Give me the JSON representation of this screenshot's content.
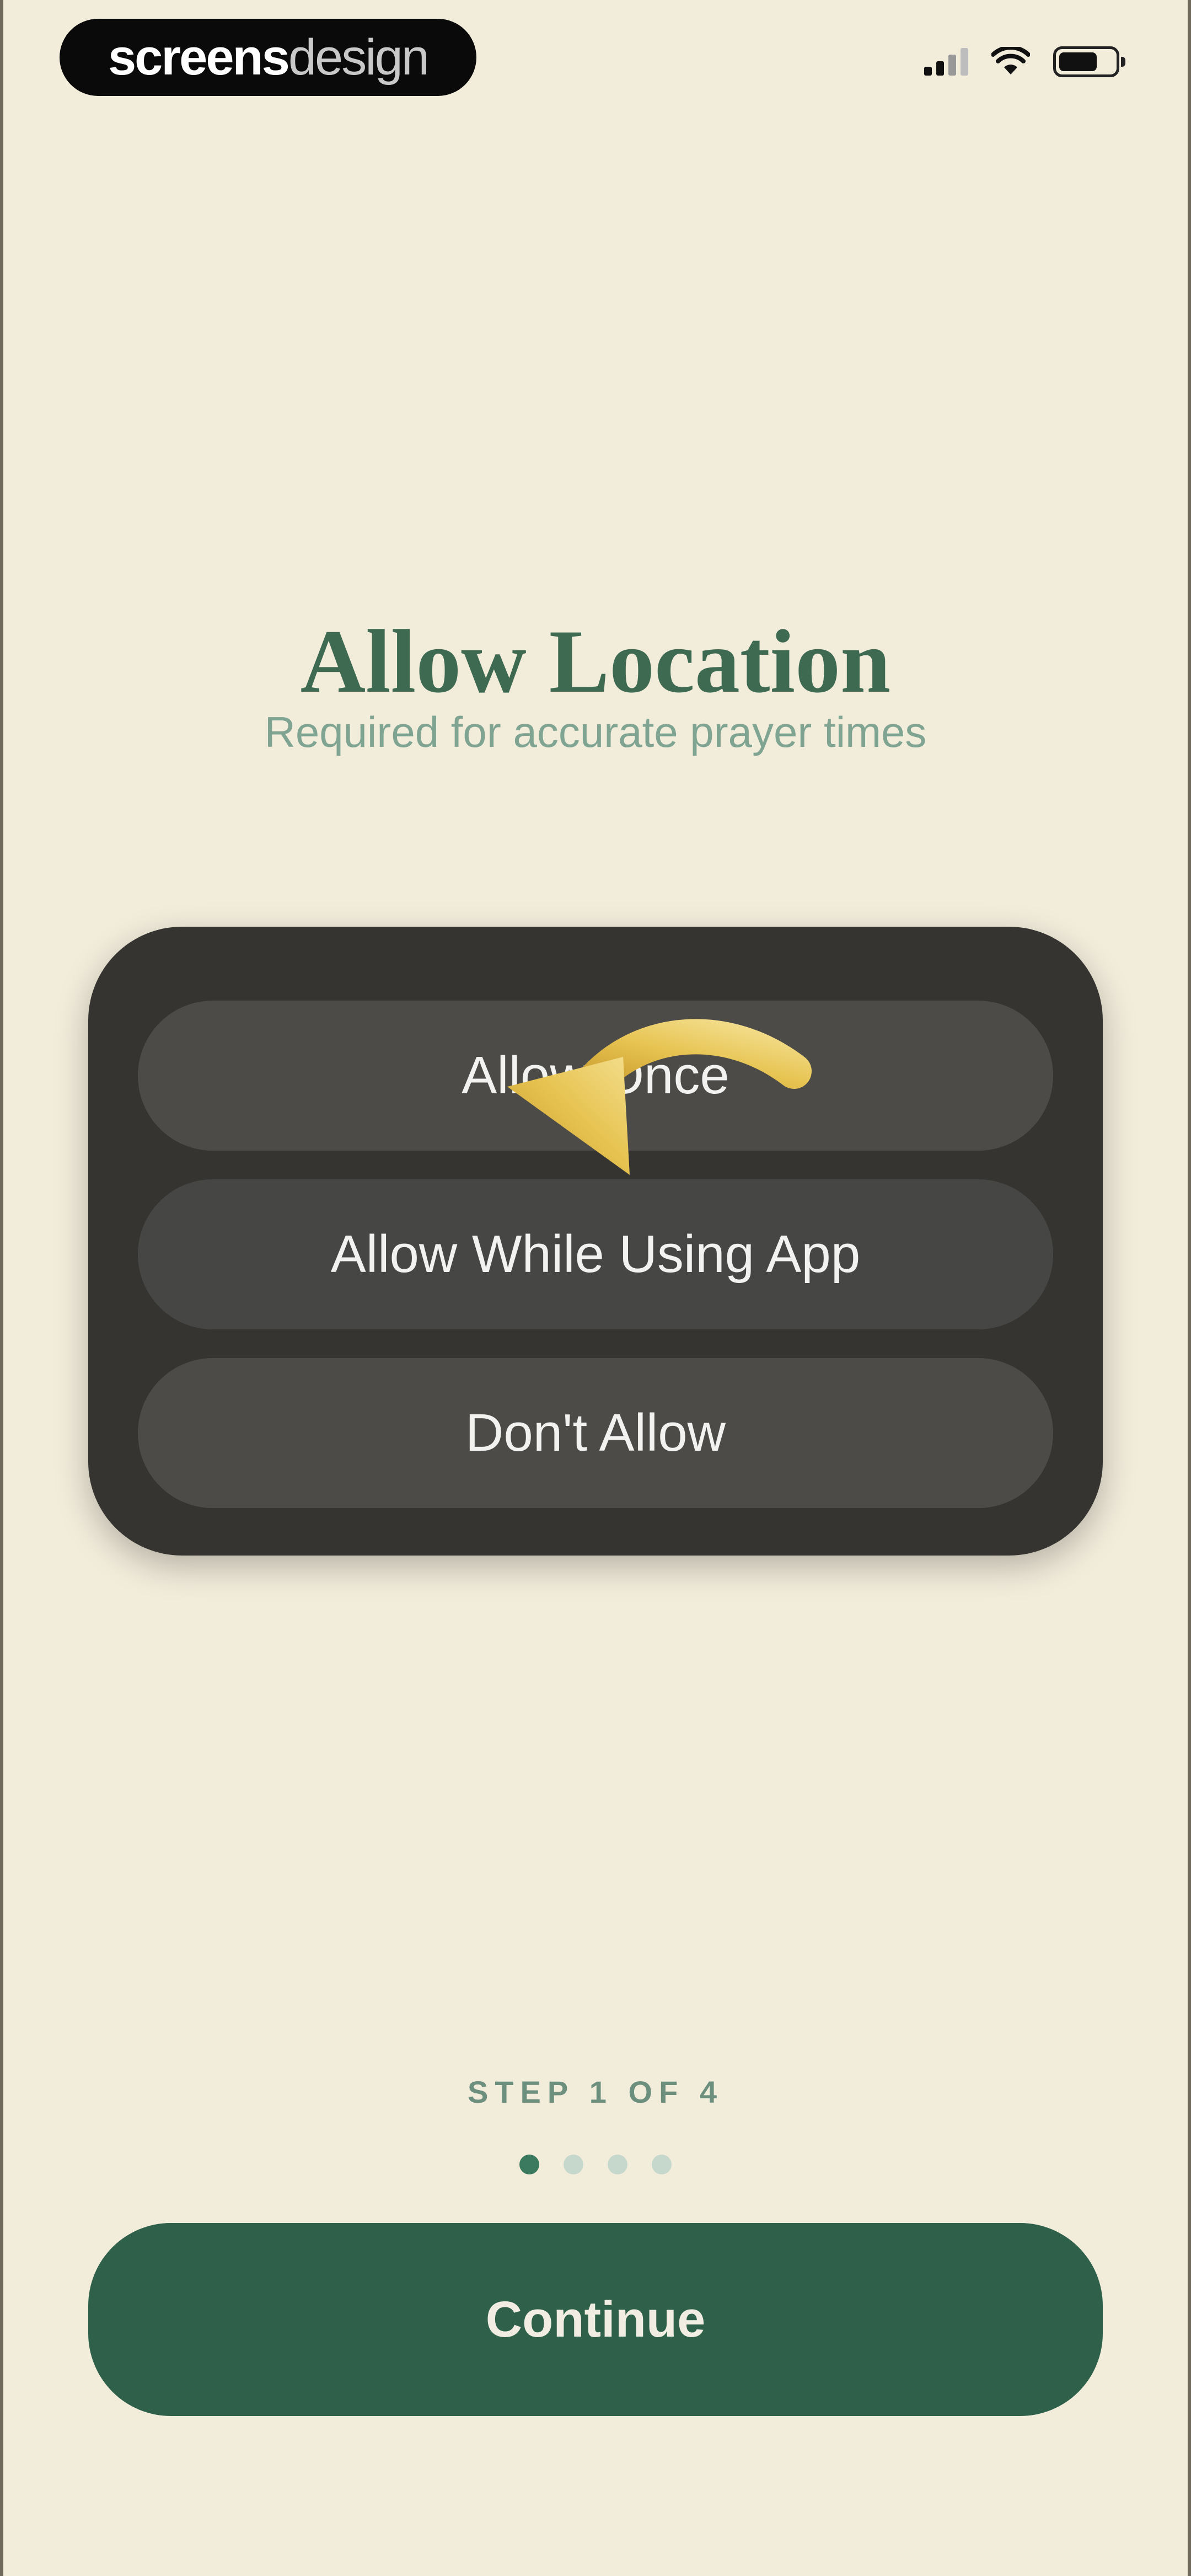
{
  "watermark": {
    "part1": "screens",
    "part2": "design"
  },
  "status_bar": {
    "icons": [
      "cellular-signal-icon",
      "wifi-icon",
      "battery-icon"
    ],
    "battery_level": 0.62
  },
  "onboarding": {
    "title": "Allow Location",
    "subtitle": "Required for accurate prayer times"
  },
  "permission_dialog": {
    "options": [
      {
        "label": "Allow Once"
      },
      {
        "label": "Allow While Using App"
      },
      {
        "label": "Don't Allow"
      }
    ],
    "pointer_icon": "curved-arrow-icon"
  },
  "progress": {
    "label": "STEP 1 OF 4",
    "current": 1,
    "total": 4
  },
  "continue_button": {
    "label": "Continue"
  },
  "colors": {
    "background": "#f2ecdb",
    "title": "#3f6a52",
    "subtitle": "#7fa491",
    "dialog": "#353431",
    "option": "#4c4b47",
    "arrow": "#e2c04a",
    "primary": "#2e604a",
    "dot_active": "#3b7a5e",
    "dot_inactive": "#c6d8cc"
  }
}
